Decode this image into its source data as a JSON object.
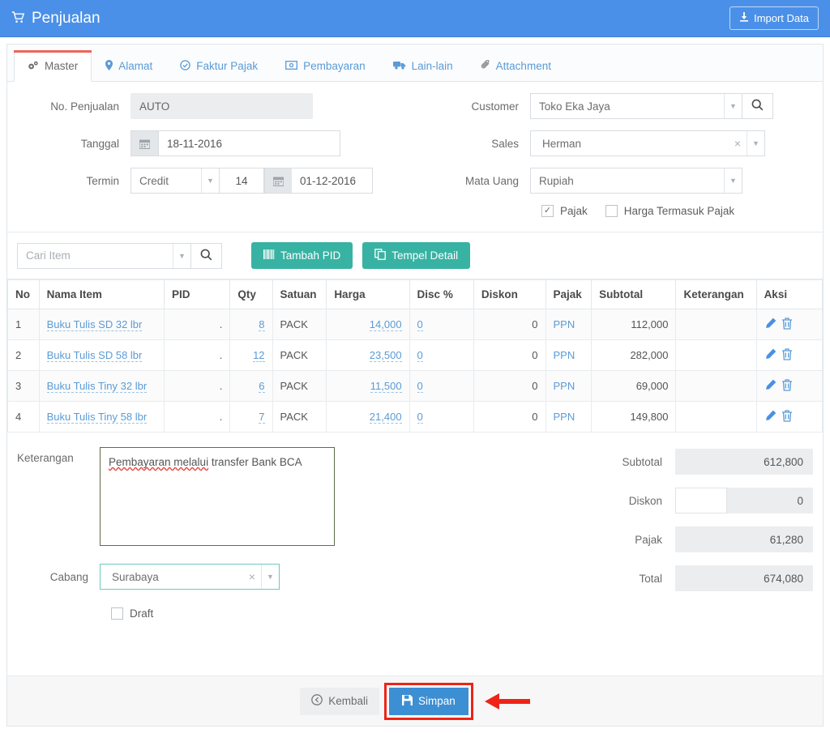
{
  "header": {
    "title": "Penjualan",
    "cart_icon": "shopping-cart-icon",
    "import_label": "Import Data",
    "import_icon": "download-icon",
    "bg_color": "#4a90e8"
  },
  "tabs": [
    {
      "label": "Master",
      "icon": "gears-icon",
      "active": true
    },
    {
      "label": "Alamat",
      "icon": "map-marker-icon",
      "active": false
    },
    {
      "label": "Faktur Pajak",
      "icon": "check-circle-icon",
      "active": false
    },
    {
      "label": "Pembayaran",
      "icon": "money-icon",
      "active": false
    },
    {
      "label": "Lain-lain",
      "icon": "truck-icon",
      "active": false
    },
    {
      "label": "Attachment",
      "icon": "paperclip-icon",
      "active": false
    }
  ],
  "form": {
    "no_penjualan": {
      "label": "No. Penjualan",
      "value": "AUTO",
      "readonly": true
    },
    "tanggal": {
      "label": "Tanggal",
      "value": "18-11-2016",
      "icon": "calendar-icon"
    },
    "termin": {
      "label": "Termin",
      "type_value": "Credit",
      "days_value": "14",
      "due_value": "01-12-2016",
      "icon": "calendar-icon"
    },
    "customer": {
      "label": "Customer",
      "value": "Toko Eka Jaya",
      "search_icon": "search-icon"
    },
    "sales": {
      "label": "Sales",
      "value": "Herman",
      "clear_icon": "clear-x-icon"
    },
    "mata_uang": {
      "label": "Mata Uang",
      "value": "Rupiah"
    },
    "pajak_checkbox": {
      "label": "Pajak",
      "checked": true,
      "mark": "✓"
    },
    "harga_termasuk_pajak_checkbox": {
      "label": "Harga Termasuk Pajak",
      "checked": false,
      "mark": ""
    }
  },
  "item_toolbar": {
    "search_placeholder": "Cari Item",
    "search_icon": "search-icon",
    "tambah_pid": {
      "label": "Tambah PID",
      "icon": "barcode-icon"
    },
    "tempel_detail": {
      "label": "Tempel Detail",
      "icon": "paste-icon"
    },
    "button_color": "#38b2a3"
  },
  "table": {
    "columns": [
      "No",
      "Nama Item",
      "PID",
      "Qty",
      "Satuan",
      "Harga",
      "Disc %",
      "Diskon",
      "Pajak",
      "Subtotal",
      "Keterangan",
      "Aksi"
    ],
    "rows": [
      {
        "no": "1",
        "nama": "Buku Tulis SD 32 lbr",
        "pid": ".",
        "qty": "8",
        "satuan": "PACK",
        "harga": "14,000",
        "disc": "0",
        "diskon": "0",
        "pajak": "PPN",
        "subtotal": "112,000",
        "keterangan": ""
      },
      {
        "no": "2",
        "nama": "Buku Tulis SD 58 lbr",
        "pid": ".",
        "qty": "12",
        "satuan": "PACK",
        "harga": "23,500",
        "disc": "0",
        "diskon": "0",
        "pajak": "PPN",
        "subtotal": "282,000",
        "keterangan": ""
      },
      {
        "no": "3",
        "nama": "Buku Tulis Tiny 32 lbr",
        "pid": ".",
        "qty": "6",
        "satuan": "PACK",
        "harga": "11,500",
        "disc": "0",
        "diskon": "0",
        "pajak": "PPN",
        "subtotal": "69,000",
        "keterangan": ""
      },
      {
        "no": "4",
        "nama": "Buku Tulis Tiny 58 lbr",
        "pid": ".",
        "qty": "7",
        "satuan": "PACK",
        "harga": "21,400",
        "disc": "0",
        "diskon": "0",
        "pajak": "PPN",
        "subtotal": "149,800",
        "keterangan": ""
      }
    ],
    "edit_icon": "pencil-icon",
    "delete_icon": "trash-icon"
  },
  "bottom": {
    "keterangan": {
      "label": "Keterangan",
      "value": "Pembayaran melalui transfer Bank BCA",
      "spell_part": "Pembayaran melalui",
      "rest_part": " transfer Bank BCA"
    },
    "cabang": {
      "label": "Cabang",
      "value": "Surabaya",
      "clear_icon": "clear-x-icon"
    },
    "draft": {
      "label": "Draft",
      "checked": false
    },
    "summary": [
      {
        "label": "Subtotal",
        "value": "612,800",
        "editable": false
      },
      {
        "label": "Diskon",
        "value": "0",
        "editable": true
      },
      {
        "label": "Pajak",
        "value": "61,280",
        "editable": false
      },
      {
        "label": "Total",
        "value": "674,080",
        "editable": false
      }
    ]
  },
  "footer": {
    "kembali": {
      "label": "Kembali",
      "icon": "back-arrow-icon"
    },
    "simpan": {
      "label": "Simpan",
      "icon": "save-disk-icon",
      "highlighted": true
    },
    "annotation_arrow": {
      "color": "#ee2418",
      "direction": "left"
    }
  }
}
